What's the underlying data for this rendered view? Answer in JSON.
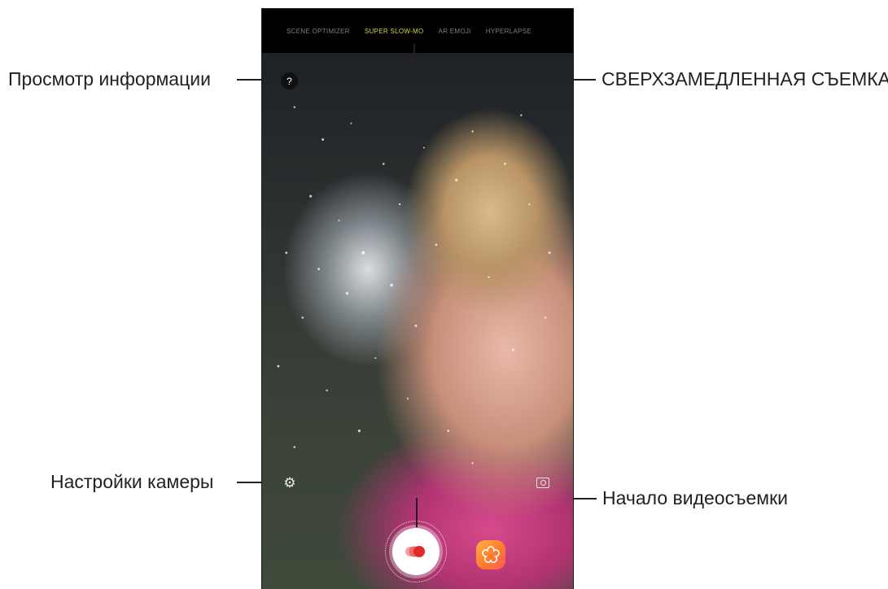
{
  "callouts": {
    "info": "Просмотр информации",
    "super_slow_mo": "СВЕРХЗАМЕДЛЕННАЯ СЪЕМКА",
    "camera_settings": "Настройки камеры",
    "start_recording": "Начало видеосъемки"
  },
  "camera": {
    "modes": [
      "SCENE OPTIMIZER",
      "SUPER SLOW-MO",
      "AR EMOJI",
      "HYPERLAPSE"
    ],
    "active_mode": "SUPER SLOW-MO",
    "help_glyph": "?",
    "icons": {
      "help": "question-mark-icon",
      "settings": "gear-icon",
      "switch_camera": "switch-camera-icon",
      "record": "record-icon",
      "bixby_vision": "bixby-vision-icon"
    }
  },
  "colors": {
    "active_mode": "#d7d23c",
    "record_dot": "#e02a2a",
    "bixby_gradient_start": "#ffb347",
    "bixby_gradient_end": "#ff5a5a"
  }
}
